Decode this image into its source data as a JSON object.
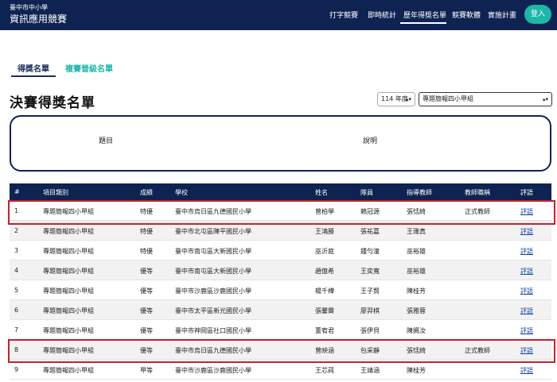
{
  "navbar": {
    "brand_sub": "臺中市中小學",
    "brand_title": "資訊應用競賽",
    "links": [
      "打字競賽",
      "即時統計",
      "歷年得獎名單",
      "競賽軟體",
      "實施計畫"
    ],
    "login": "登入"
  },
  "tabs": [
    "得獎名單",
    "複賽晉級名單"
  ],
  "page_title": "決賽得獎名單",
  "filters": {
    "year": "114 年度",
    "category": "專題簡報四小甲組"
  },
  "info_box": {
    "col1": "題目",
    "col2": "說明"
  },
  "table": {
    "headers": [
      "#",
      "項目類別",
      "成績",
      "學校",
      "姓名",
      "隊員",
      "指導教師",
      "教師職稱",
      "評語"
    ],
    "rows": [
      [
        "1",
        "專題簡報四小甲組",
        "特優",
        "臺中市烏日區九德國民小學",
        "曾柏學",
        "賴冠源",
        "張恬綺",
        "正式教師",
        "評語"
      ],
      [
        "2",
        "專題簡報四小甲組",
        "特優",
        "臺中市北屯區陳平國民小學",
        "王鴻勝",
        "張祐嘉",
        "王珊真",
        "",
        "評語"
      ],
      [
        "3",
        "專題簡報四小甲組",
        "特優",
        "臺中市南屯區大新國民小學",
        "巫沂庭",
        "鍾勻潼",
        "巫裕雄",
        "",
        "評語"
      ],
      [
        "4",
        "專題簡報四小甲組",
        "優等",
        "臺中市南屯區大新國民小學",
        "趙億希",
        "王奕寬",
        "巫裕雄",
        "",
        "評語"
      ],
      [
        "5",
        "專題簡報四小甲組",
        "優等",
        "臺中市沙鹿區沙鹿國民小學",
        "楊千樺",
        "王子賢",
        "陳桂芳",
        "",
        "評語"
      ],
      [
        "6",
        "專題簡報四小甲組",
        "優等",
        "臺中市太平區新光國民小學",
        "張馨霽",
        "廖羿棋",
        "張雅蓉",
        "",
        "評語"
      ],
      [
        "7",
        "專題簡報四小甲組",
        "優等",
        "臺中市神岡區社口國民小學",
        "董宥君",
        "張伊貝",
        "陳姵汝",
        "",
        "評語"
      ],
      [
        "8",
        "專題簡報四小甲組",
        "優等",
        "臺中市烏日區九德國民小學",
        "曾映涵",
        "包采靜",
        "張恬綺",
        "正式教師",
        "評語"
      ],
      [
        "9",
        "專題簡報四小甲組",
        "甲等",
        "臺中市沙鹿區沙鹿國民小學",
        "王芯莼",
        "王靖涵",
        "陳桂芳",
        "",
        "評語"
      ]
    ]
  },
  "colors": {
    "navy": "#0f2352",
    "teal": "#1db7a8",
    "highlight": "#c8202e",
    "link": "#1a4aa8"
  }
}
